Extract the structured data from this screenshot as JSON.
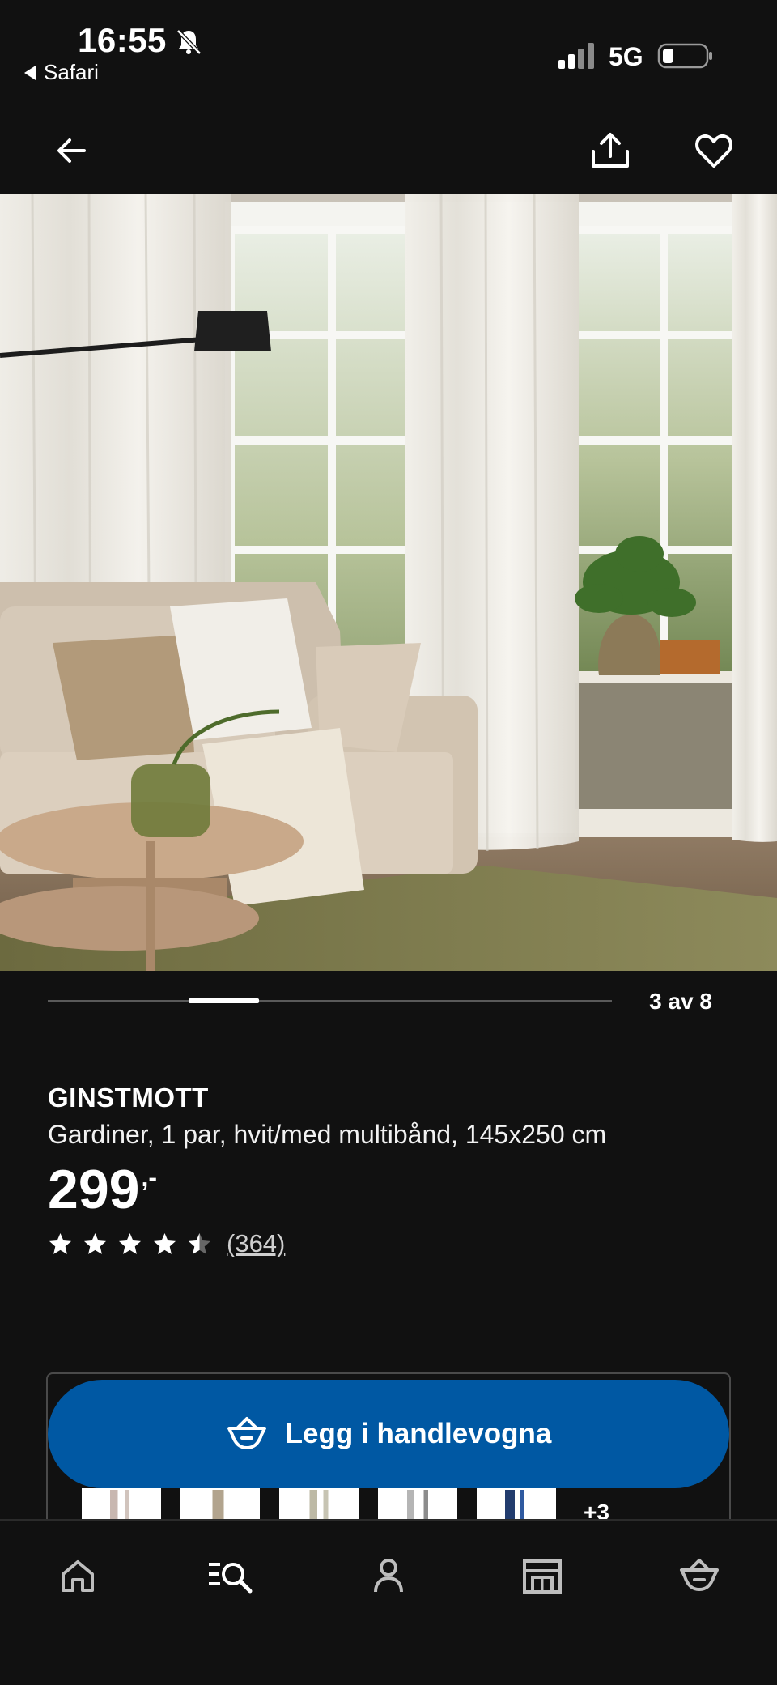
{
  "status_bar": {
    "time": "16:55",
    "back_app": "Safari",
    "network": "5G"
  },
  "icons": {
    "back": "arrow-left-icon",
    "share": "share-icon",
    "favorite": "heart-icon",
    "cart": "basket-icon",
    "tabs": [
      "home-icon",
      "search-icon",
      "profile-icon",
      "store-icon",
      "basket-icon"
    ]
  },
  "gallery": {
    "counter": "3 av 8",
    "current": 3,
    "total": 8
  },
  "product": {
    "brand": "GINSTMOTT",
    "description": "Gardiner, 1 par, hvit/med multibånd, 145x250 cm",
    "price": "299",
    "price_suffix": ",-",
    "rating": 4.5,
    "review_count": "(364)"
  },
  "cta": {
    "label": "Legg i handlevogna"
  },
  "variants": {
    "more": "+3"
  },
  "colors": {
    "background": "#111111",
    "accent": "#0058a3",
    "text": "#ffffff"
  }
}
